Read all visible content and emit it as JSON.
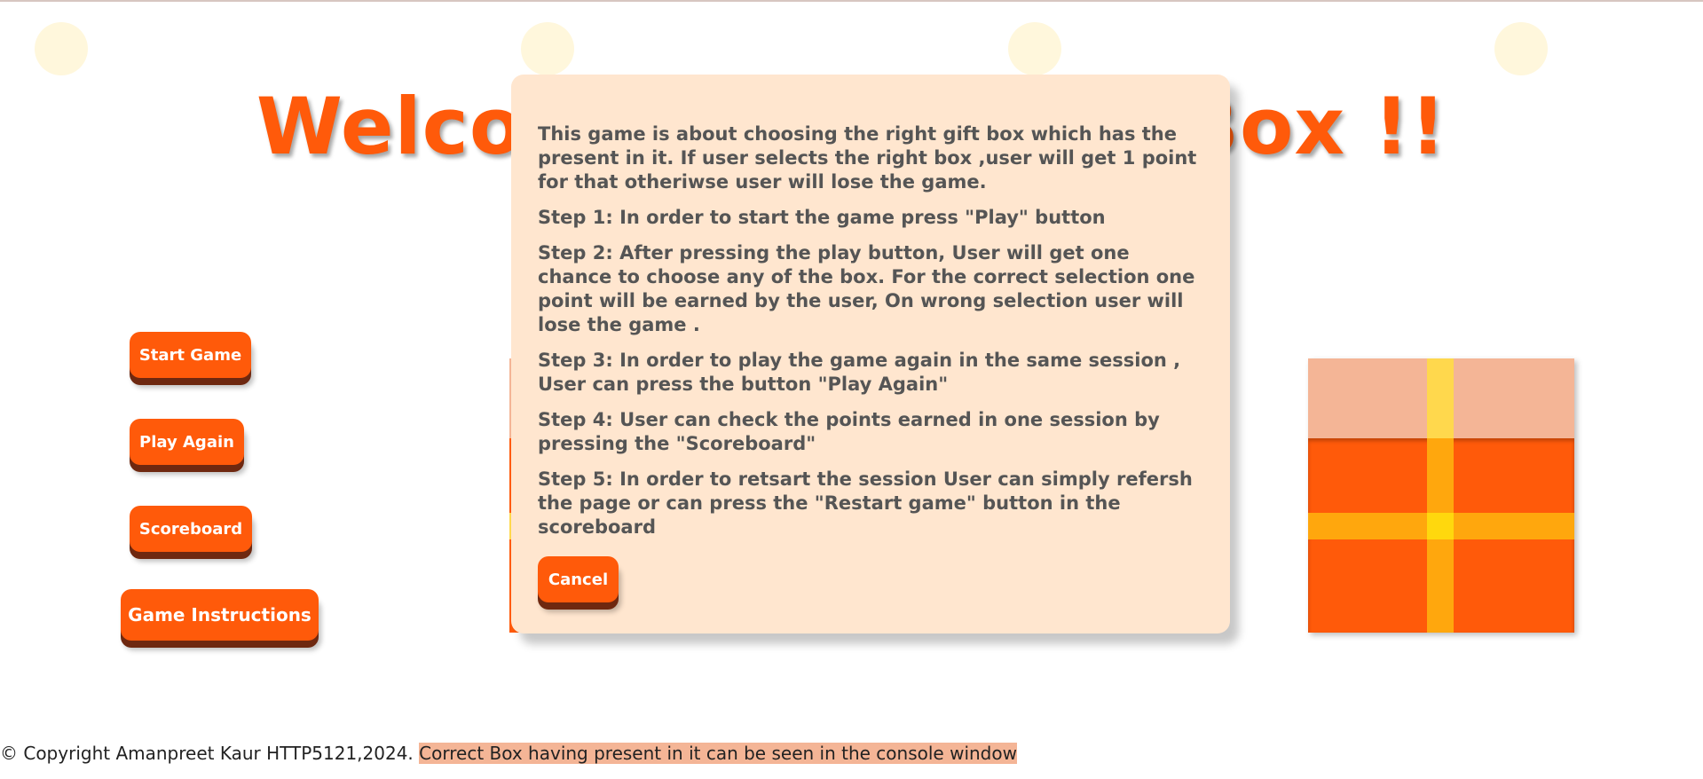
{
  "title": "Welcome to the Gift Box !!",
  "menu": {
    "start_label": "Start Game",
    "play_again_label": "Play Again",
    "scoreboard_label": "Scoreboard",
    "instructions_label": "Game Instructions"
  },
  "modal": {
    "paragraphs": [
      "This game is about choosing the right gift box which has the present in it. If user selects the right box ,user will get 1 point for that otheriwse user will lose the game.",
      "Step 1: In order to start the game press \"Play\" button",
      "Step 2: After pressing the play button, User will get one chance to choose any of the box. For the correct selection one point will be earned by the user, On wrong selection user will lose the game .",
      "Step 3: In order to play the game again in the same session , User can press the button \"Play Again\"",
      "Step 4: User can check the points earned in one session by pressing the \"Scoreboard\"",
      "Step 5: In order to retsart the session User can simply refersh the page or can press the \"Restart game\" button in the scoreboard"
    ],
    "cancel_label": "Cancel"
  },
  "footer": {
    "copyright": "© Copyright Amanpreet Kaur HTTP5121,2024.",
    "note": "Correct Box having present in it can be seen in the console window"
  },
  "colors": {
    "accent": "#ff5a0a",
    "shadow": "#6e2810",
    "modal_bg": "#ffe6cf",
    "lid": "#f4b596",
    "ribbon": "#ffa70d"
  }
}
